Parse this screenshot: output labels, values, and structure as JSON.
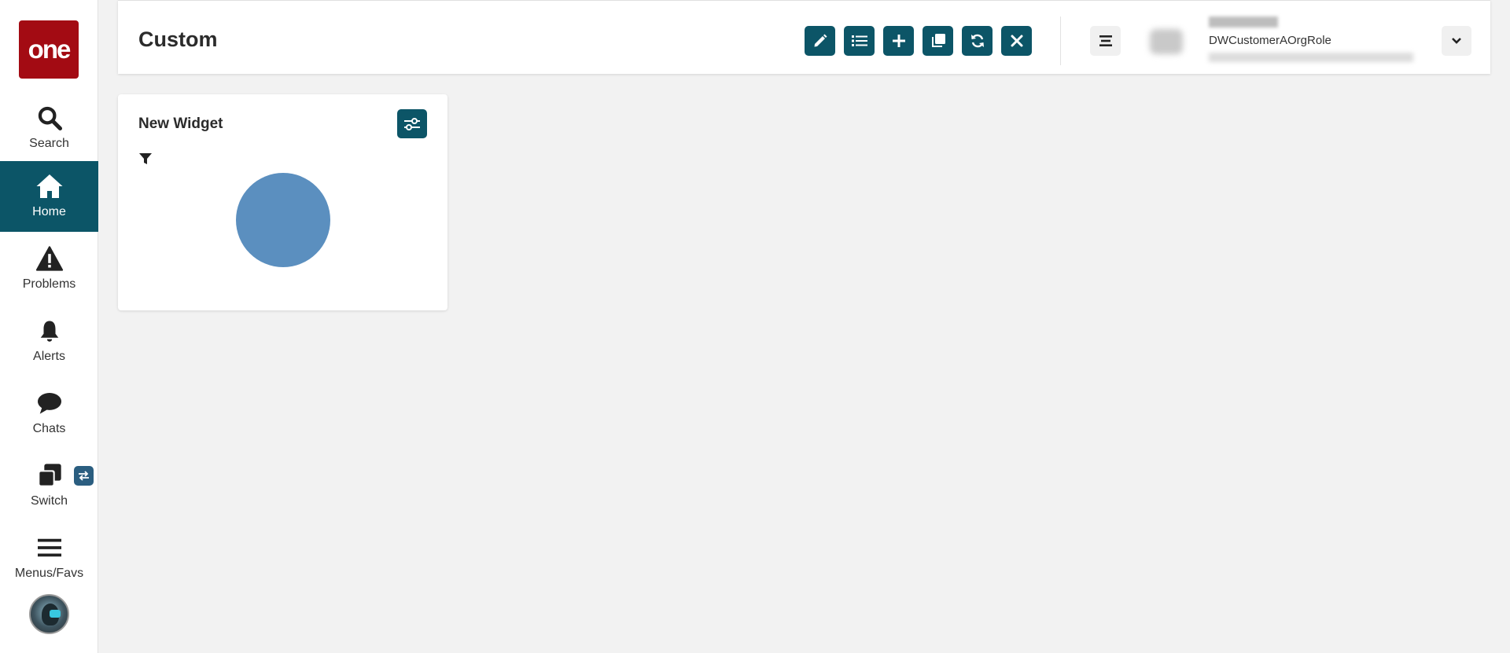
{
  "sidebar": {
    "logo_text": "one",
    "items": [
      {
        "label": "Search",
        "icon": "search-icon",
        "active": false
      },
      {
        "label": "Home",
        "icon": "home-icon",
        "active": true
      },
      {
        "label": "Problems",
        "icon": "warning-icon",
        "active": false
      },
      {
        "label": "Alerts",
        "icon": "bell-icon",
        "active": false
      },
      {
        "label": "Chats",
        "icon": "chat-bubble-icon",
        "active": false
      },
      {
        "label": "Switch",
        "icon": "switch-windows-icon",
        "active": false
      },
      {
        "label": "Menus/Favs",
        "icon": "hamburger-icon",
        "active": false
      }
    ],
    "switch_badge_icon": "swap-arrows-icon"
  },
  "header": {
    "title": "Custom",
    "toolbar": [
      "edit-pencil-icon",
      "list-icon",
      "plus-icon",
      "copy-icon",
      "refresh-icon",
      "close-icon"
    ],
    "user_role": "DWCustomerAOrgRole"
  },
  "widget": {
    "title": "New Widget"
  },
  "chart_data": {
    "type": "pie",
    "values": [
      1
    ],
    "colors": [
      "#5b8fbf"
    ]
  },
  "colors": {
    "brand_red": "#a30b13",
    "accent": "#0c5567",
    "background": "#f2f2f2"
  }
}
